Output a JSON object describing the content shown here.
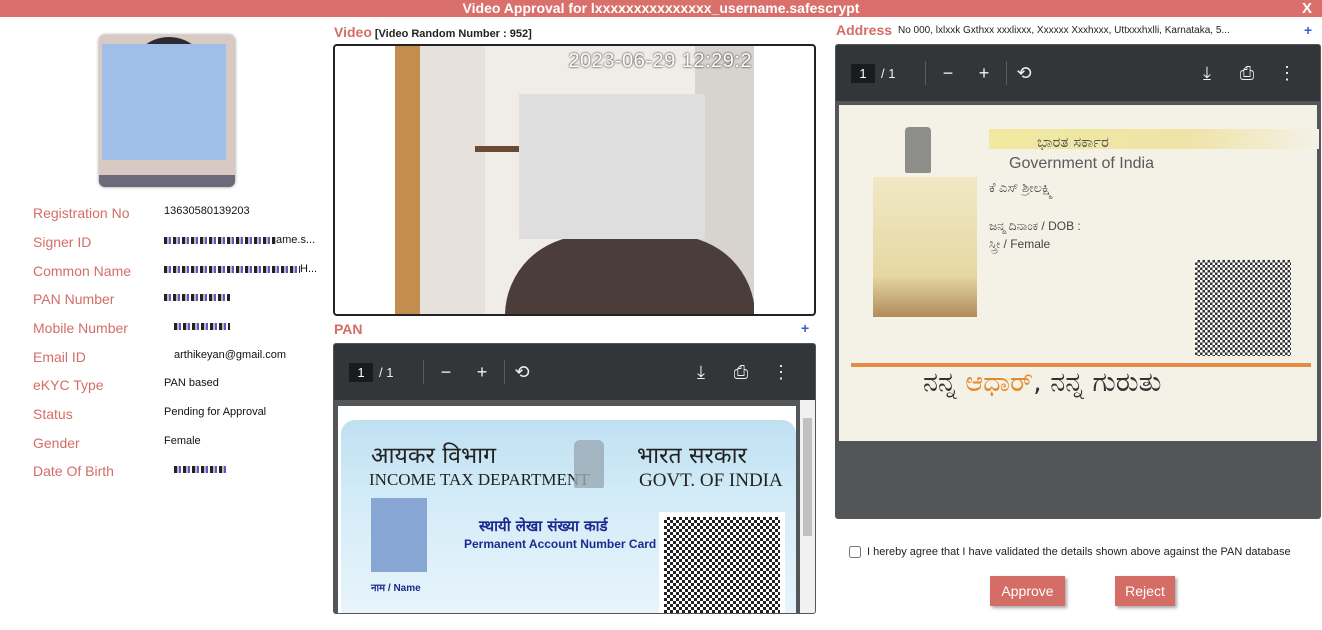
{
  "header": {
    "title": "Video Approval for lxxxxxxxxxxxxxxx_username.safescrypt",
    "close_label": "X"
  },
  "profile": {
    "fields": [
      {
        "label": "Registration No",
        "value": "13630580139203"
      },
      {
        "label": "Signer ID",
        "value": "ame.s..."
      },
      {
        "label": "Common Name",
        "value": "H..."
      },
      {
        "label": "PAN Number",
        "value": ""
      },
      {
        "label": "Mobile Number",
        "value": ""
      },
      {
        "label": "Email ID",
        "value": "arthikeyan@gmail.com"
      },
      {
        "label": "eKYC Type",
        "value": "PAN based"
      },
      {
        "label": "Status",
        "value": "Pending for Approval"
      },
      {
        "label": "Gender",
        "value": "Female"
      },
      {
        "label": "Date Of Birth",
        "value": ""
      }
    ]
  },
  "video": {
    "title": "Video",
    "random_number_label": "[Video Random Number : 952]",
    "timestamp": "2023-06-29 12:29:2"
  },
  "pan": {
    "title": "PAN",
    "plus": "+",
    "viewer": {
      "page": "1",
      "total": "/ 1"
    },
    "card": {
      "dept_hindi": "आयकर विभाग",
      "dept_english": "INCOME TAX DEPARTMENT",
      "govt_hindi": "भारत सरकार",
      "govt_english": "GOVT. OF INDIA",
      "card_hindi": "स्थायी लेखा संख्या कार्ड",
      "card_english": "Permanent Account Number Card",
      "name_label": "नाम / Name"
    }
  },
  "address": {
    "title": "Address",
    "value": "No 000, lxlxxk Gxthxx xxxlixxx, Xxxxxx Xxxhxxx, Uttxxxhxlli, Karnataka, 5...",
    "plus": "+",
    "viewer": {
      "page": "1",
      "total": "/ 1"
    },
    "card": {
      "govt_kannada": "ಭಾರತ ಸರ್ಕಾರ",
      "govt_english": "Government of India",
      "name_kannada": "ಕೆ ಎಸ್ ಶ್ರೀಲಕ್ಷ್ಮಿ",
      "dob_label": "ಜನ್ಮ ದಿನಾಂಕ / DOB :",
      "gender": "ಸ್ತ್ರೀ / Female",
      "footer_part1": "ನನ್ನ ",
      "footer_aadhaar": "ಆಧಾರ್",
      "footer_part2": ", ನನ್ನ ಗುರುತು"
    }
  },
  "agreement": {
    "text": "I hereby agree that I have validated the details shown above against the PAN database",
    "checked": false
  },
  "actions": {
    "approve_label": "Approve",
    "reject_label": "Reject"
  },
  "colors": {
    "accent": "#d46d66",
    "header_bg": "#d9706b",
    "pdf_toolbar": "#323639",
    "plus_blue": "#3b5bd6"
  },
  "icons": {
    "zoom_out": "minus-icon",
    "zoom_in": "plus-icon",
    "rotate": "rotate-icon",
    "download": "download-icon",
    "print": "print-icon",
    "more": "more-vertical-icon"
  }
}
